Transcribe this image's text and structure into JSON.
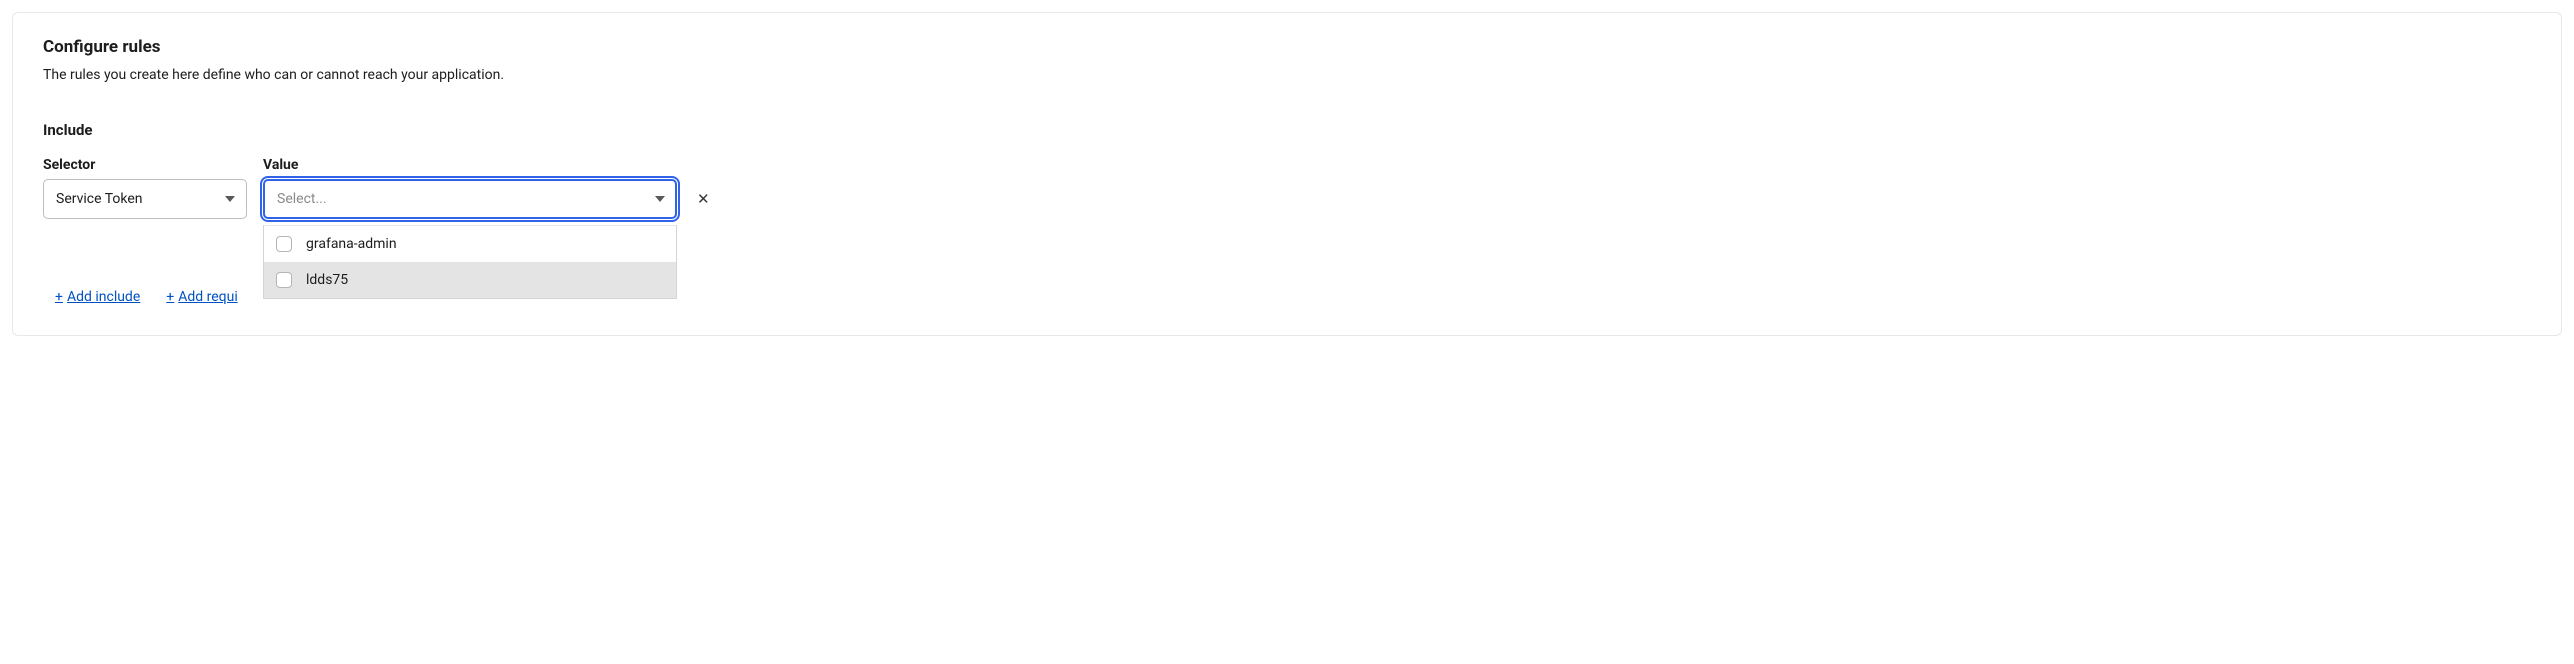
{
  "header": {
    "title": "Configure rules",
    "description": "The rules you create here define who can or cannot reach your application."
  },
  "include_section": {
    "heading": "Include",
    "selector_label": "Selector",
    "value_label": "Value",
    "selector_value": "Service Token",
    "value_placeholder": "Select...",
    "remove_symbol": "✕"
  },
  "dropdown": {
    "options": [
      {
        "label": "grafana-admin",
        "highlighted": false
      },
      {
        "label": "ldds75",
        "highlighted": true
      }
    ]
  },
  "actions": {
    "plus": "+",
    "add_include": "Add include",
    "add_require_prefix": "Add requi"
  }
}
